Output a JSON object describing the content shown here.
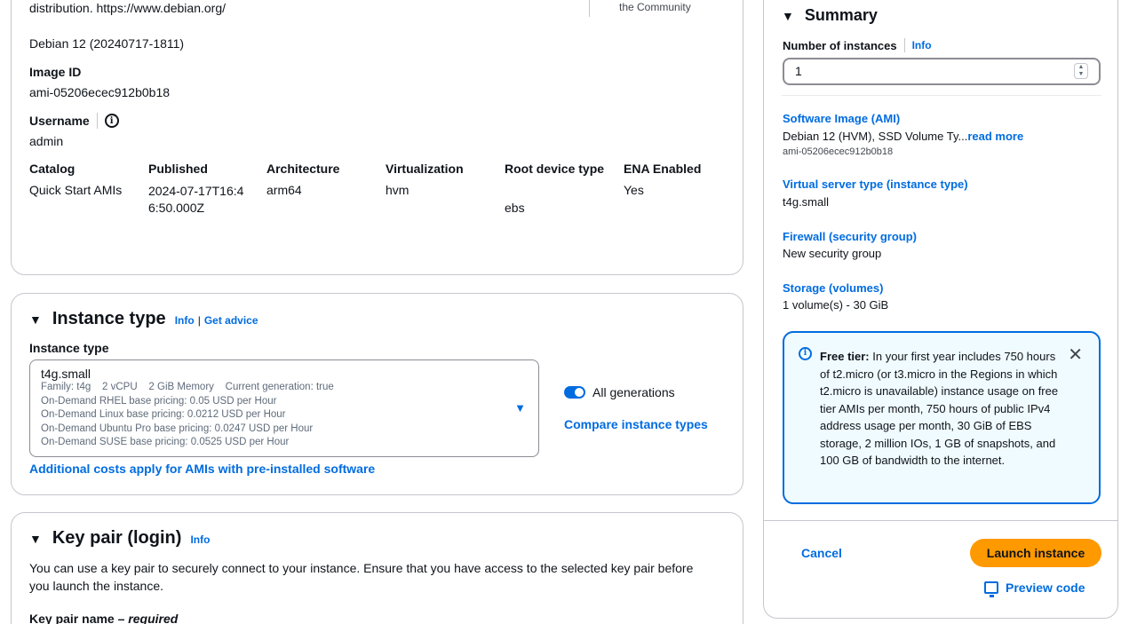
{
  "ami": {
    "description": "distribution. https://www.debian.org/",
    "community": "the Community",
    "version": "Debian 12 (20240717-1811)",
    "image_id_label": "Image ID",
    "image_id": "ami-05206ecec912b0b18",
    "username_label": "Username",
    "username_info_icon": "info-circle-icon",
    "username": "admin",
    "columns": [
      {
        "label": "Catalog",
        "value": "Quick Start AMIs"
      },
      {
        "label": "Published",
        "value": "2024-07-17T16:4\n6:50.000Z"
      },
      {
        "label": "Architecture",
        "value": "arm64"
      },
      {
        "label": "Virtualization",
        "value": "hvm"
      },
      {
        "label": "Root device type",
        "value": "ebs"
      },
      {
        "label": "ENA Enabled",
        "value": "Yes"
      }
    ]
  },
  "instance_type": {
    "section_title": "Instance type",
    "info": "Info",
    "separator": "|",
    "get_advice": "Get advice",
    "field_label": "Instance type",
    "selected": "t4g.small",
    "details": [
      "Family: t4g    2 vCPU    2 GiB Memory    Current generation: true",
      "On-Demand RHEL base pricing: 0.05 USD per Hour",
      "On-Demand Linux base pricing: 0.0212 USD per Hour",
      "On-Demand Ubuntu Pro base pricing: 0.0247 USD per Hour",
      "On-Demand SUSE base pricing: 0.0525 USD per Hour"
    ],
    "all_generations": "All generations",
    "all_generations_on": true,
    "compare": "Compare instance types",
    "additional_costs": "Additional costs apply for AMIs with pre-installed software"
  },
  "key_pair": {
    "section_title": "Key pair (login)",
    "info": "Info",
    "text": "You can use a key pair to securely connect to your instance. Ensure that you have access to the selected key pair before you launch the instance.",
    "name_label": "Key pair name – ",
    "required": "required"
  },
  "summary": {
    "title": "Summary",
    "num_instances_label": "Number of instances",
    "info": "Info",
    "num_instances": "1",
    "software_image_label": "Software Image (AMI)",
    "software_image_value": "Debian 12 (HVM), SSD Volume Ty...",
    "read_more": "read more",
    "software_image_id": "ami-05206ecec912b0b18",
    "server_type_label": "Virtual server type (instance type)",
    "server_type_value": "t4g.small",
    "firewall_label": "Firewall (security group)",
    "firewall_value": "New security group",
    "storage_label": "Storage (volumes)",
    "storage_value": "1 volume(s) - 30 GiB",
    "free_tier_bold": "Free tier:",
    "free_tier_text": " In your first year includes 750 hours of t2.micro (or t3.micro in the Regions in which t2.micro is unavailable) instance usage on free tier AMIs per month, 750 hours of public IPv4 address usage per month, 30 GiB of EBS storage, 2 million IOs, 1 GB of snapshots, and 100 GB of bandwidth to the internet.",
    "cancel": "Cancel",
    "launch": "Launch instance",
    "preview_code": "Preview code"
  }
}
